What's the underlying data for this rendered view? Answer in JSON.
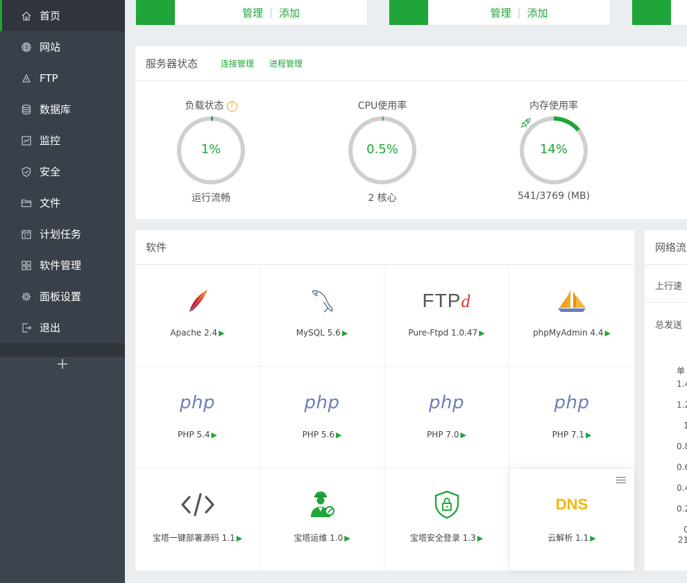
{
  "sidebar": {
    "items": [
      {
        "label": "首页",
        "icon": "home-icon",
        "active": true
      },
      {
        "label": "网站",
        "icon": "globe-icon"
      },
      {
        "label": "FTP",
        "icon": "ftp-icon"
      },
      {
        "label": "数据库",
        "icon": "database-icon"
      },
      {
        "label": "监控",
        "icon": "monitor-icon"
      },
      {
        "label": "安全",
        "icon": "shield-icon"
      },
      {
        "label": "文件",
        "icon": "folder-icon"
      },
      {
        "label": "计划任务",
        "icon": "calendar-icon"
      },
      {
        "label": "软件管理",
        "icon": "grid-icon"
      },
      {
        "label": "面板设置",
        "icon": "gear-icon"
      },
      {
        "label": "退出",
        "icon": "logout-icon"
      }
    ],
    "add_label": "+"
  },
  "top_cards": [
    {
      "manage": "管理",
      "sep": "|",
      "add": "添加"
    },
    {
      "manage": "管理",
      "sep": "|",
      "add": "添加"
    }
  ],
  "status": {
    "title": "服务器状态",
    "link1": "连接管理",
    "link2": "进程管理",
    "help": "?",
    "gauges": [
      {
        "label": "负载状态",
        "value": "1%",
        "fraction": 0.01,
        "sub": "运行流畅"
      },
      {
        "label": "CPU使用率",
        "value": "0.5%",
        "fraction": 0.005,
        "sub": "2 核心"
      },
      {
        "label": "内存使用率",
        "value": "14%",
        "fraction": 0.14,
        "sub": "541/3769 (MB)"
      }
    ]
  },
  "software": {
    "title": "软件",
    "items": [
      {
        "name": "Apache 2.4",
        "logo": "apache-feather-icon"
      },
      {
        "name": "MySQL 5.6",
        "logo": "mysql-dolphin-icon"
      },
      {
        "name": "Pure-Ftpd 1.0.47",
        "logo": "pureftpd-logo",
        "logo_text": "FTP",
        "logo_mark": "d"
      },
      {
        "name": "phpMyAdmin 4.4",
        "logo": "phpmyadmin-sailboat-icon"
      },
      {
        "name": "PHP 5.4",
        "logo": "php-logo",
        "logo_text": "php"
      },
      {
        "name": "PHP 5.6",
        "logo": "php-logo",
        "logo_text": "php"
      },
      {
        "name": "PHP 7.0",
        "logo": "php-logo",
        "logo_text": "php"
      },
      {
        "name": "PHP 7.1",
        "logo": "php-logo",
        "logo_text": "php"
      },
      {
        "name": "宝塔一键部署源码 1.1",
        "logo": "code-brackets-icon"
      },
      {
        "name": "宝塔运维 1.0",
        "logo": "ops-engineer-icon"
      },
      {
        "name": "宝塔安全登录 1.3",
        "logo": "secure-lock-shield-icon"
      },
      {
        "name": "云解析 1.1",
        "logo": "dns-logo",
        "logo_text": "DNS"
      }
    ],
    "arrow": "▶"
  },
  "network": {
    "title": "网络流",
    "upload": "上行速",
    "total_sent": "总发送",
    "unit": "单",
    "ticks": [
      "1.4",
      "1.2",
      "1",
      "0.8",
      "0.6",
      "0.4",
      "0.2",
      "0"
    ],
    "last_tick": "21"
  },
  "colors": {
    "accent": "#20a53a",
    "sidebar": "#3c444d"
  }
}
